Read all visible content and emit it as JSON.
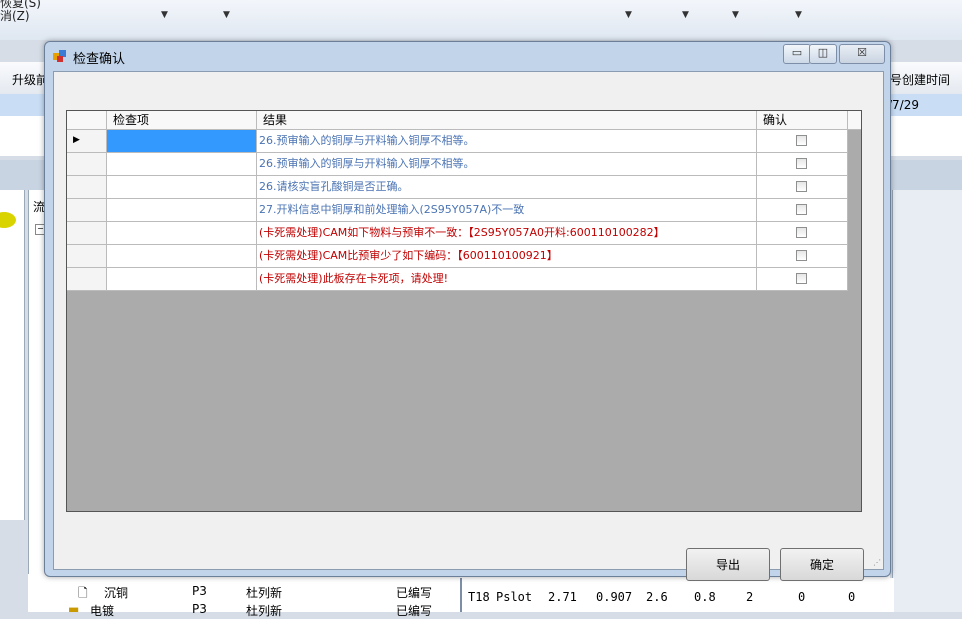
{
  "background": {
    "menu_line1": "恢复(S)",
    "menu_line2": "消(Z)",
    "toolbar_left": "升级前",
    "toolbar_right": "号创建时间",
    "row_date": "/7/29",
    "tree_header": "流",
    "tree_rows": [
      {
        "name": "沉铜",
        "code": "P3",
        "person": "杜列新",
        "status": "已编写"
      },
      {
        "name": "电镀",
        "code": "P3",
        "person": "杜列新",
        "status": "已编写"
      }
    ],
    "grid_row": {
      "c1": "T18",
      "c2": "Pslot",
      "c3": "2.71",
      "c4": "0.907",
      "c5": "2.6",
      "c6": "0.8",
      "c7": "2",
      "c8": "0",
      "c9": "0"
    }
  },
  "dialog": {
    "title": "检查确认",
    "min_glyph": "▭",
    "max_glyph": "◫",
    "close_glyph": "☒",
    "columns": {
      "check_item": "检查项",
      "result": "结果",
      "confirm": "确认"
    },
    "rows": [
      {
        "result": "26.预审输入的铜厚与开料输入铜厚不相等。",
        "color": "blue"
      },
      {
        "result": "26.预审输入的铜厚与开料输入铜厚不相等。",
        "color": "blue"
      },
      {
        "result": "26.请核实盲孔酸铜是否正确。",
        "color": "blue"
      },
      {
        "result": "27.开料信息中铜厚和前处理输入(2S95Y057A)不一致",
        "color": "blue"
      },
      {
        "result": "(卡死需处理)CAM如下物料与预审不一致：【2S95Y057A0开料:600110100282】",
        "color": "red"
      },
      {
        "result": "(卡死需处理)CAM比预审少了如下编码：【600110100921】",
        "color": "red"
      },
      {
        "result": "(卡死需处理)此板存在卡死项，请处理!",
        "color": "red"
      }
    ],
    "buttons": {
      "export": "导出",
      "ok": "确定"
    }
  }
}
